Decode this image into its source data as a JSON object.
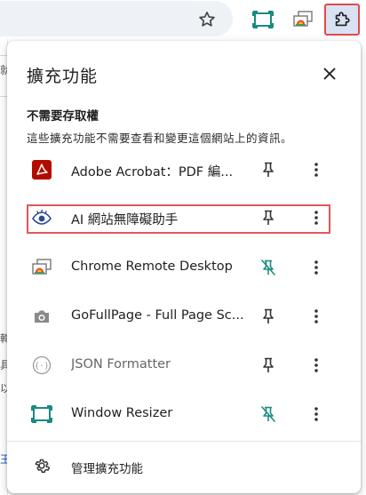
{
  "popup": {
    "title": "擴充功能",
    "section_heading": "不需要存取權",
    "section_desc": "這些擴充功能不需要查看和變更這個網站上的資訊。",
    "manage_label": "管理擴充功能"
  },
  "extensions": [
    {
      "name": "Adobe Acrobat：PDF 編...",
      "icon": "adobe-acrobat-icon",
      "pinned": false
    },
    {
      "name": "AI 網站無障礙助手",
      "icon": "eye-icon",
      "pinned": false
    },
    {
      "name": "Chrome Remote Desktop",
      "icon": "remote-desktop-icon",
      "pinned": true
    },
    {
      "name": "GoFullPage - Full Page Sc...",
      "icon": "camera-icon",
      "pinned": false
    },
    {
      "name": "JSON Formatter",
      "icon": "json-braces-icon",
      "pinned": false
    },
    {
      "name": "Window Resizer",
      "icon": "window-resize-icon",
      "pinned": true
    }
  ],
  "background_text": {
    "chars": [
      "就",
      "轉",
      "具",
      "以",
      "王"
    ]
  },
  "colors": {
    "accent_highlight": "#e0575b",
    "pinned_teal": "#1a8a80",
    "adobe_red": "#b30b00",
    "toolbar_extension_bg": "#d9e2f3"
  }
}
